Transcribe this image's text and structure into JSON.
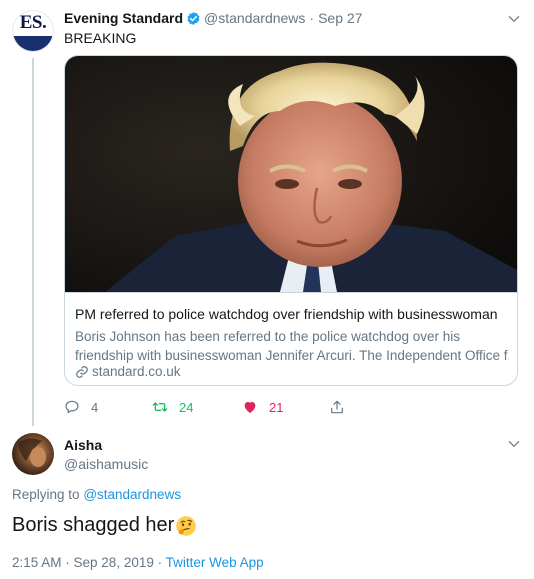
{
  "parent_tweet": {
    "avatar_text": "ES.",
    "name": "Evening Standard",
    "handle": "@standardnews",
    "separator": "·",
    "date": "Sep 27",
    "text": "BREAKING",
    "card": {
      "title": "PM referred to police watchdog over friendship with businesswoman",
      "desc_line1": "Boris Johnson has been referred to the police watchdog over his",
      "desc_line2": "friendship with businesswoman Jennifer Arcuri. The Independent Office f...",
      "url": "standard.co.uk"
    },
    "actions": {
      "replies": "4",
      "retweets": "24",
      "likes": "21"
    }
  },
  "reply_tweet": {
    "name": "Aisha",
    "handle": "@aishamusic",
    "replying_prefix": "Replying to",
    "replying_to": "@standardnews",
    "text": "Boris shagged her",
    "emoji": "thinking-face",
    "timestamp": "2:15 AM · Sep 28, 2019 ·",
    "app": "Twitter Web App"
  },
  "colors": {
    "accent_blue": "#1da1f2",
    "link_blue": "#1b95e0",
    "retweet_green": "#17bf63",
    "like_red": "#e0245e",
    "muted": "#657786"
  }
}
